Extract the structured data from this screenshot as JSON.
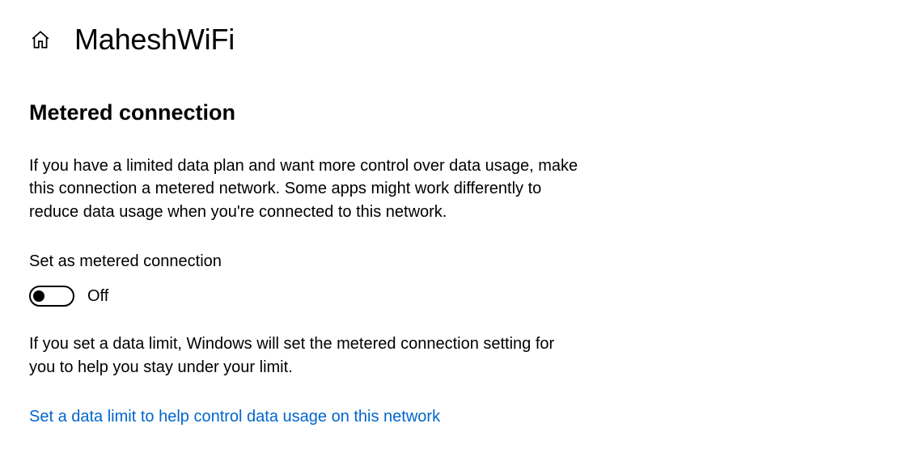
{
  "header": {
    "title": "MaheshWiFi"
  },
  "section": {
    "heading": "Metered connection",
    "description": "If you have a limited data plan and want more control over data usage, make this connection a metered network. Some apps might work differently to reduce data usage when you're connected to this network.",
    "toggle_label": "Set as metered connection",
    "toggle_state": "Off",
    "info_text": "If you set a data limit, Windows will set the metered connection setting for you to help you stay under your limit.",
    "link_text": "Set a data limit to help control data usage on this network"
  }
}
